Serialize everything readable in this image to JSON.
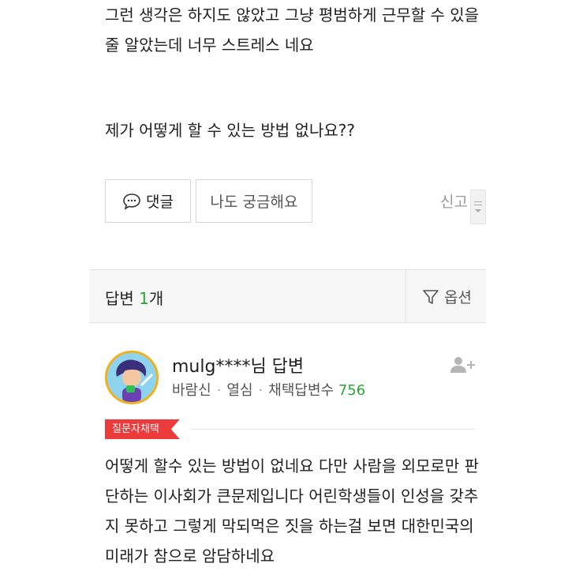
{
  "question": {
    "paragraph1": "그런 생각은 하지도 않았고 그냥 평범하게 근무할 수 있을줄 알았는데 너무 스트레스 네요",
    "paragraph2": "제가 어떻게 할 수 있는 방법 없나요??"
  },
  "actions": {
    "comment_label": "댓글",
    "curious_label": "나도 궁금해요",
    "report_label": "신고"
  },
  "answers_header": {
    "title": "답변",
    "count": "1",
    "count_unit": "개",
    "options_label": "옵션"
  },
  "answer": {
    "username": "mulg****님 답변",
    "level": "바람신",
    "activity": "열심",
    "adopt_label": "채택답변수",
    "adopt_count": "756",
    "badge": "질문자채택",
    "body": "어떻게 할수 있는 방법이 없네요 다만 사람을 외모로만 판단하는 이사회가 큰문제입니다 어린학생들이 인성을 갖추지 못하고 그렇게 막되먹은 짓을 하는걸 보면 대한민국의 미래가 참으로 암담하네요"
  },
  "colors": {
    "accent_green": "#27a836",
    "badge_red": "#ec3b3b",
    "avatar_ring": "#f2b01e"
  },
  "icons": [
    "comment-bubble-icon",
    "filter-icon",
    "add-friend-icon",
    "scroll-handle-icon"
  ]
}
